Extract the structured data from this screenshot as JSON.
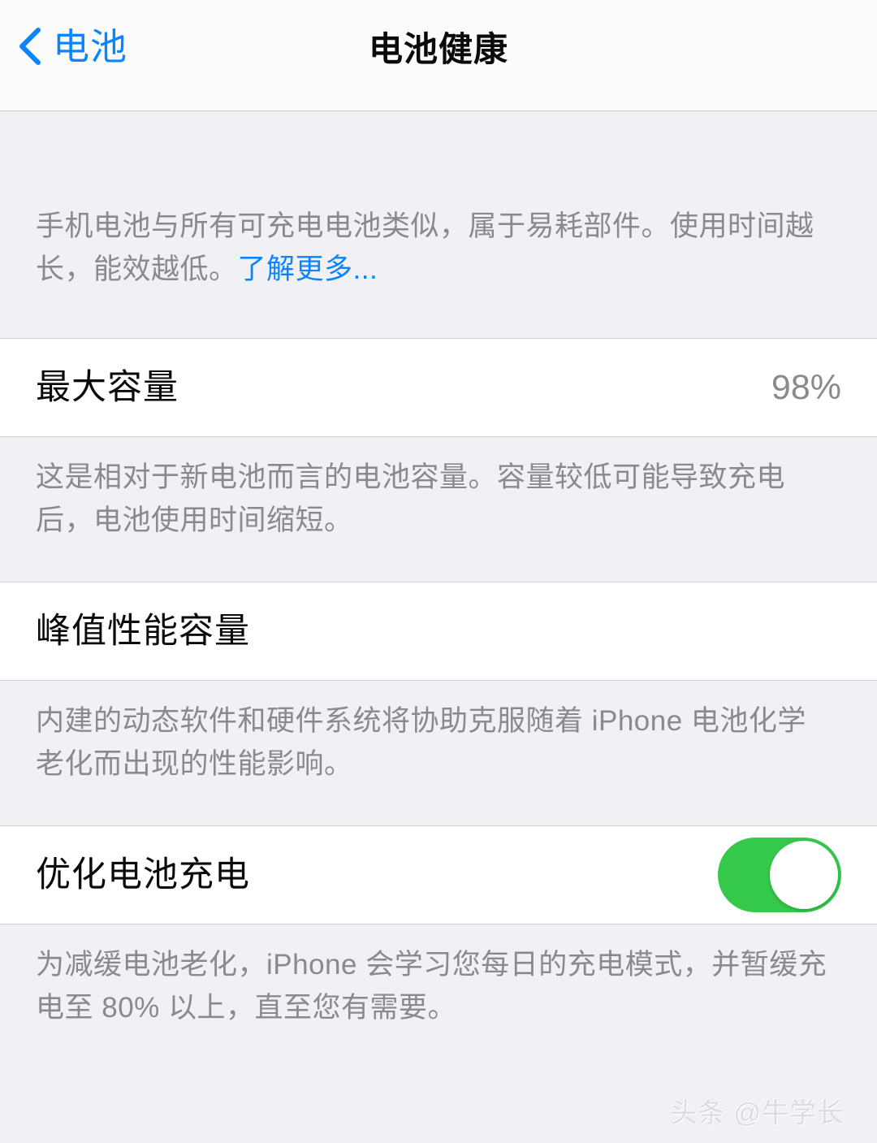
{
  "navbar": {
    "back_label": "电池",
    "back_icon": "chevron-left-icon",
    "title": "电池健康"
  },
  "intro": {
    "text": "手机电池与所有可充电电池类似，属于易耗部件。使用时间越长，能效越低。",
    "link_label": "了解更多..."
  },
  "max_capacity": {
    "title": "最大容量",
    "value": "98%",
    "footer": "这是相对于新电池而言的电池容量。容量较低可能导致充电后，电池使用时间缩短。"
  },
  "peak_performance": {
    "title": "峰值性能容量",
    "footer": "内建的动态软件和硬件系统将协助克服随着 iPhone 电池化学老化而出现的性能影响。"
  },
  "optimized_charging": {
    "title": "优化电池充电",
    "toggle_state": "on",
    "footer": "为减缓电池老化，iPhone 会学习您每日的充电模式，并暂缓充电至 80% 以上，直至您有需要。"
  },
  "watermark": {
    "text": "头条 @牛学长"
  },
  "colors": {
    "accent_blue": "#0A84FF",
    "toggle_green": "#34C94B",
    "value_gray": "#8A8A8E",
    "page_background": "#F1F0F4",
    "card_background": "#FFFFFF"
  }
}
